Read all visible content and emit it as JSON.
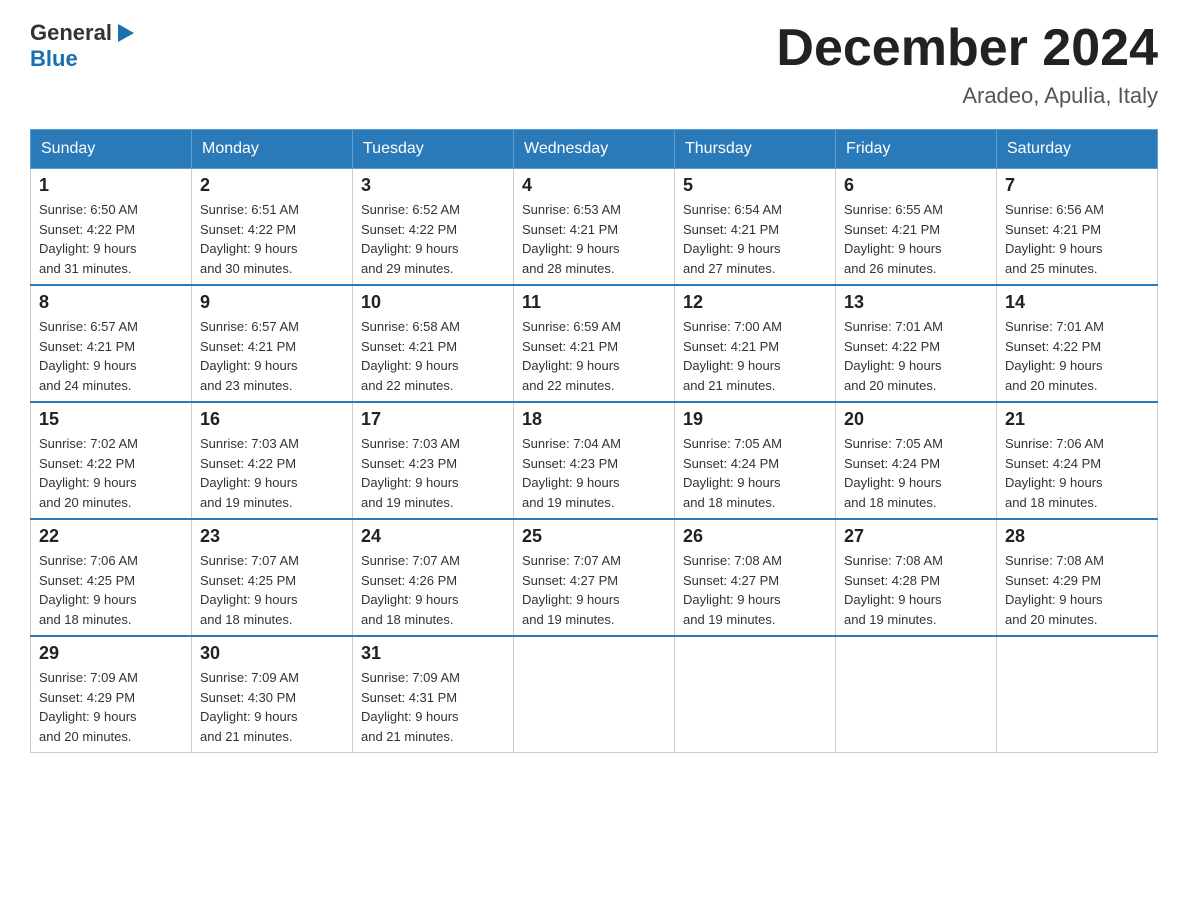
{
  "header": {
    "title": "December 2024",
    "subtitle": "Aradeo, Apulia, Italy",
    "logo_general": "General",
    "logo_blue": "Blue"
  },
  "days_of_week": [
    "Sunday",
    "Monday",
    "Tuesday",
    "Wednesday",
    "Thursday",
    "Friday",
    "Saturday"
  ],
  "weeks": [
    [
      {
        "day": "1",
        "sunrise": "6:50 AM",
        "sunset": "4:22 PM",
        "daylight": "9 hours and 31 minutes."
      },
      {
        "day": "2",
        "sunrise": "6:51 AM",
        "sunset": "4:22 PM",
        "daylight": "9 hours and 30 minutes."
      },
      {
        "day": "3",
        "sunrise": "6:52 AM",
        "sunset": "4:22 PM",
        "daylight": "9 hours and 29 minutes."
      },
      {
        "day": "4",
        "sunrise": "6:53 AM",
        "sunset": "4:21 PM",
        "daylight": "9 hours and 28 minutes."
      },
      {
        "day": "5",
        "sunrise": "6:54 AM",
        "sunset": "4:21 PM",
        "daylight": "9 hours and 27 minutes."
      },
      {
        "day": "6",
        "sunrise": "6:55 AM",
        "sunset": "4:21 PM",
        "daylight": "9 hours and 26 minutes."
      },
      {
        "day": "7",
        "sunrise": "6:56 AM",
        "sunset": "4:21 PM",
        "daylight": "9 hours and 25 minutes."
      }
    ],
    [
      {
        "day": "8",
        "sunrise": "6:57 AM",
        "sunset": "4:21 PM",
        "daylight": "9 hours and 24 minutes."
      },
      {
        "day": "9",
        "sunrise": "6:57 AM",
        "sunset": "4:21 PM",
        "daylight": "9 hours and 23 minutes."
      },
      {
        "day": "10",
        "sunrise": "6:58 AM",
        "sunset": "4:21 PM",
        "daylight": "9 hours and 22 minutes."
      },
      {
        "day": "11",
        "sunrise": "6:59 AM",
        "sunset": "4:21 PM",
        "daylight": "9 hours and 22 minutes."
      },
      {
        "day": "12",
        "sunrise": "7:00 AM",
        "sunset": "4:21 PM",
        "daylight": "9 hours and 21 minutes."
      },
      {
        "day": "13",
        "sunrise": "7:01 AM",
        "sunset": "4:22 PM",
        "daylight": "9 hours and 20 minutes."
      },
      {
        "day": "14",
        "sunrise": "7:01 AM",
        "sunset": "4:22 PM",
        "daylight": "9 hours and 20 minutes."
      }
    ],
    [
      {
        "day": "15",
        "sunrise": "7:02 AM",
        "sunset": "4:22 PM",
        "daylight": "9 hours and 20 minutes."
      },
      {
        "day": "16",
        "sunrise": "7:03 AM",
        "sunset": "4:22 PM",
        "daylight": "9 hours and 19 minutes."
      },
      {
        "day": "17",
        "sunrise": "7:03 AM",
        "sunset": "4:23 PM",
        "daylight": "9 hours and 19 minutes."
      },
      {
        "day": "18",
        "sunrise": "7:04 AM",
        "sunset": "4:23 PM",
        "daylight": "9 hours and 19 minutes."
      },
      {
        "day": "19",
        "sunrise": "7:05 AM",
        "sunset": "4:24 PM",
        "daylight": "9 hours and 18 minutes."
      },
      {
        "day": "20",
        "sunrise": "7:05 AM",
        "sunset": "4:24 PM",
        "daylight": "9 hours and 18 minutes."
      },
      {
        "day": "21",
        "sunrise": "7:06 AM",
        "sunset": "4:24 PM",
        "daylight": "9 hours and 18 minutes."
      }
    ],
    [
      {
        "day": "22",
        "sunrise": "7:06 AM",
        "sunset": "4:25 PM",
        "daylight": "9 hours and 18 minutes."
      },
      {
        "day": "23",
        "sunrise": "7:07 AM",
        "sunset": "4:25 PM",
        "daylight": "9 hours and 18 minutes."
      },
      {
        "day": "24",
        "sunrise": "7:07 AM",
        "sunset": "4:26 PM",
        "daylight": "9 hours and 18 minutes."
      },
      {
        "day": "25",
        "sunrise": "7:07 AM",
        "sunset": "4:27 PM",
        "daylight": "9 hours and 19 minutes."
      },
      {
        "day": "26",
        "sunrise": "7:08 AM",
        "sunset": "4:27 PM",
        "daylight": "9 hours and 19 minutes."
      },
      {
        "day": "27",
        "sunrise": "7:08 AM",
        "sunset": "4:28 PM",
        "daylight": "9 hours and 19 minutes."
      },
      {
        "day": "28",
        "sunrise": "7:08 AM",
        "sunset": "4:29 PM",
        "daylight": "9 hours and 20 minutes."
      }
    ],
    [
      {
        "day": "29",
        "sunrise": "7:09 AM",
        "sunset": "4:29 PM",
        "daylight": "9 hours and 20 minutes."
      },
      {
        "day": "30",
        "sunrise": "7:09 AM",
        "sunset": "4:30 PM",
        "daylight": "9 hours and 21 minutes."
      },
      {
        "day": "31",
        "sunrise": "7:09 AM",
        "sunset": "4:31 PM",
        "daylight": "9 hours and 21 minutes."
      },
      null,
      null,
      null,
      null
    ]
  ],
  "labels": {
    "sunrise": "Sunrise:",
    "sunset": "Sunset:",
    "daylight": "Daylight:"
  }
}
